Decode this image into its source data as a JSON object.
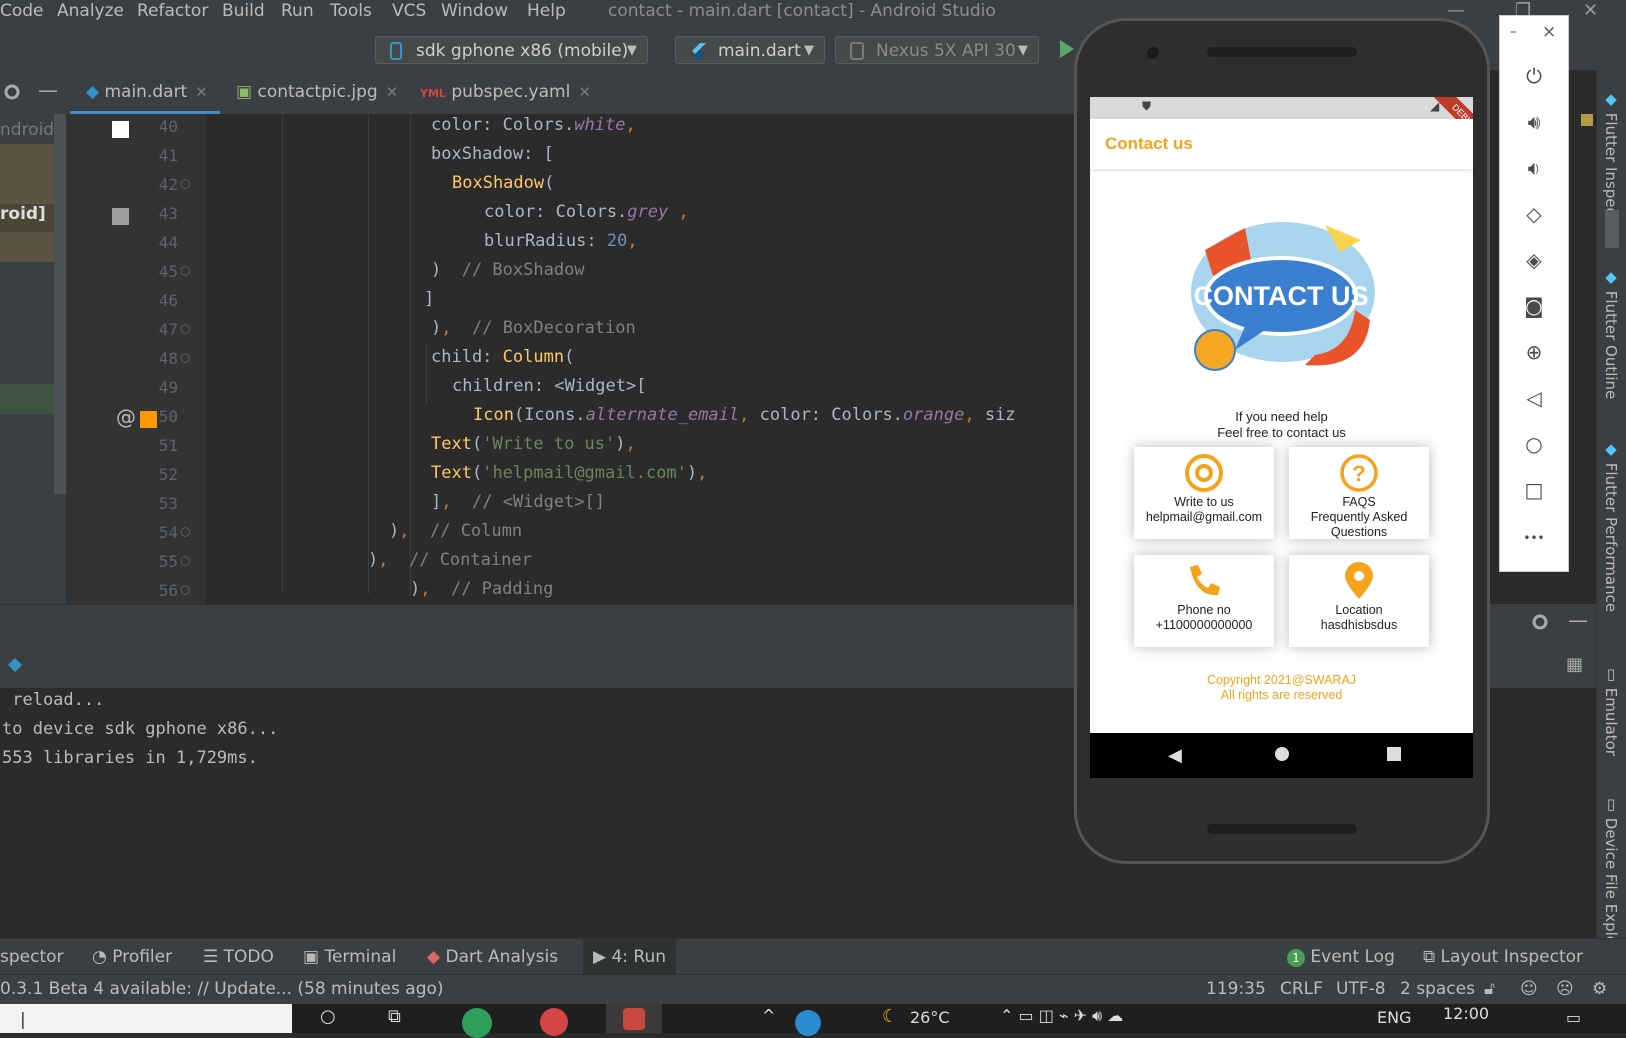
{
  "window": {
    "title": "contact - main.dart [contact] - Android Studio",
    "menu": [
      "Code",
      "Analyze",
      "Refactor",
      "Build",
      "Run",
      "Tools",
      "VCS",
      "Window",
      "Help"
    ]
  },
  "toolbar": {
    "device_selector": "sdk gphone x86 (mobile)",
    "run_config": "main.dart",
    "avd_selector": "Nexus 5X API 30"
  },
  "tabs": [
    {
      "label": "main.dart",
      "active": true
    },
    {
      "label": "contactpic.jpg",
      "active": false
    },
    {
      "label": "pubspec.yaml",
      "active": false
    }
  ],
  "project_panel": {
    "item_1": "ndroidSt",
    "item_2": "roid]"
  },
  "editor": {
    "line_numbers": [
      "40",
      "41",
      "42",
      "43",
      "44",
      "45",
      "46",
      "47",
      "48",
      "49",
      "50",
      "51",
      "52",
      "53",
      "54",
      "55",
      "56"
    ],
    "lines": [
      {
        "parts": [
          [
            "",
            "color: Colors."
          ],
          [
            "it",
            "white"
          ],
          [
            "kw",
            ","
          ]
        ]
      },
      {
        "parts": [
          [
            "",
            "boxShadow: ["
          ]
        ]
      },
      {
        "parts": [
          [
            "fn",
            "BoxShadow"
          ],
          [
            "",
            "("
          ]
        ]
      },
      {
        "parts": [
          [
            "",
            "color: Colors."
          ],
          [
            "it",
            "grey"
          ],
          [
            "kw",
            " ,"
          ]
        ]
      },
      {
        "parts": [
          [
            "",
            "blurRadius: "
          ],
          [
            "num",
            "20"
          ],
          [
            "kw",
            ","
          ]
        ]
      },
      {
        "parts": [
          [
            "",
            ")  "
          ],
          [
            "cm",
            "// BoxShadow"
          ]
        ]
      },
      {
        "parts": [
          [
            "",
            "]"
          ]
        ]
      },
      {
        "parts": [
          [
            "",
            ")"
          ],
          [
            "kw",
            ","
          ],
          [
            "",
            "  "
          ],
          [
            "cm",
            "// BoxDecoration"
          ]
        ]
      },
      {
        "parts": [
          [
            "",
            "child: "
          ],
          [
            "fn",
            "Column"
          ],
          [
            "",
            "("
          ]
        ]
      },
      {
        "parts": [
          [
            "",
            "children: <Widget>["
          ]
        ]
      },
      {
        "parts": [
          [
            "fn",
            "Icon"
          ],
          [
            "",
            "(Icons."
          ],
          [
            "it",
            "alternate_email"
          ],
          [
            "kw",
            ","
          ],
          [
            "",
            " color: Colors."
          ],
          [
            "it",
            "orange"
          ],
          [
            "kw",
            ","
          ],
          [
            "",
            " siz"
          ]
        ]
      },
      {
        "parts": [
          [
            "fn",
            "Text"
          ],
          [
            "",
            "("
          ],
          [
            "str",
            "'Write to us'"
          ],
          [
            "",
            ")"
          ],
          [
            "kw",
            ","
          ]
        ]
      },
      {
        "parts": [
          [
            "fn",
            "Text"
          ],
          [
            "",
            "("
          ],
          [
            "str",
            "'helpmail@gmail.com'"
          ],
          [
            "",
            ")"
          ],
          [
            "kw",
            ","
          ]
        ]
      },
      {
        "parts": [
          [
            "",
            "]"
          ],
          [
            "kw",
            ","
          ],
          [
            "",
            "  "
          ],
          [
            "cm",
            "// <Widget>[]"
          ]
        ]
      },
      {
        "parts": [
          [
            "",
            ")"
          ],
          [
            "kw",
            ","
          ],
          [
            "",
            "  "
          ],
          [
            "cm",
            "// Column"
          ]
        ]
      },
      {
        "parts": [
          [
            "",
            ")"
          ],
          [
            "kw",
            ","
          ],
          [
            "",
            "  "
          ],
          [
            "cm",
            "// Container"
          ]
        ]
      },
      {
        "parts": [
          [
            "",
            ")"
          ],
          [
            "kw",
            ","
          ],
          [
            "",
            "  "
          ],
          [
            "cm",
            "// Padding"
          ]
        ]
      }
    ]
  },
  "console": {
    "lines": [
      " reload...",
      "to device sdk gphone x86...",
      "553 libraries in 1,729ms."
    ]
  },
  "tool_windows": {
    "inspector": "spector",
    "profiler": "Profiler",
    "todo": "TODO",
    "terminal": "Terminal",
    "dart_analysis": "Dart Analysis",
    "run": "4: Run",
    "event_log_count": "1",
    "event_log": "Event Log",
    "layout_inspector": "Layout Inspector"
  },
  "statusbar": {
    "message": "0.3.1 Beta 4 available: // Update... (58 minutes ago)",
    "position": "119:35",
    "line_sep": "CRLF",
    "encoding": "UTF-8",
    "indent": "2 spaces"
  },
  "right_strip": {
    "flutter_inspector": "Flutter Inspector",
    "flutter_outline": "Flutter Outline",
    "flutter_performance": "Flutter Performance",
    "emulator": "Emulator",
    "device_file_explorer": "Device File Explor"
  },
  "taskbar": {
    "temperature": "26°C",
    "lang": "ENG",
    "time": "12:00"
  },
  "app": {
    "debug_banner": "DEBUG",
    "appbar_title": "Contact us",
    "hero_text": "CONTACT US",
    "help_line_1": "If you need help",
    "help_line_2": "Feel free to contact us",
    "cards": [
      {
        "icon": "at-icon",
        "title": "Write to us",
        "subtitle": "helpmail@gmail.com"
      },
      {
        "icon": "question-icon",
        "title": "FAQS",
        "subtitle": "Frequently Asked Questions"
      },
      {
        "icon": "phone-icon",
        "title": "Phone no",
        "subtitle": "+1100000000000"
      },
      {
        "icon": "location-pin-icon",
        "title": "Location",
        "subtitle": "hasdhisbsdus"
      }
    ],
    "footer_1": "Copyright 2021@SWARAJ",
    "footer_2": "All rights are reserved"
  },
  "emulator_panel": {
    "close": "×",
    "minimize": "–",
    "more": "•••"
  },
  "colors": {
    "accent_orange": "#f7a21b",
    "ide_bg": "#2b2b2b",
    "ide_panel": "#3c3f41",
    "hero_blue": "#3a7fd0"
  }
}
